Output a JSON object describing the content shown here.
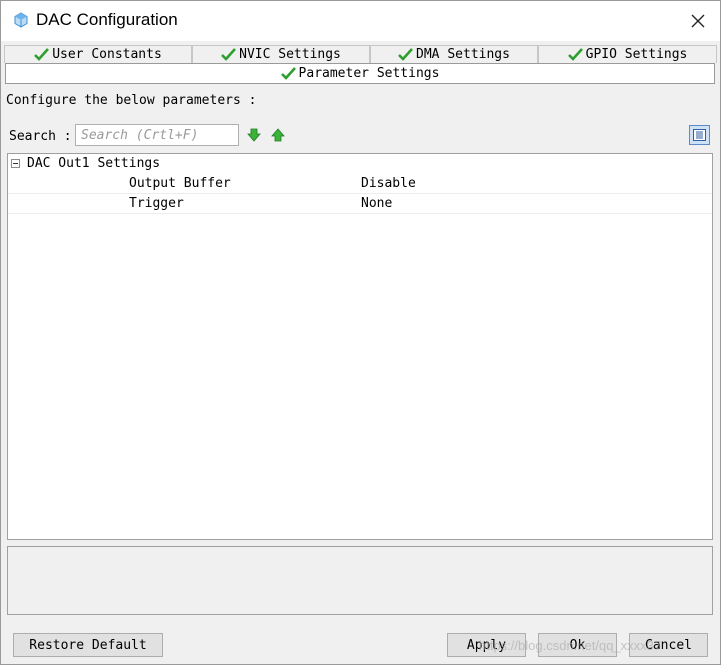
{
  "window": {
    "title": "DAC Configuration"
  },
  "tabs": [
    {
      "label": "User Constants",
      "checked": true
    },
    {
      "label": "NVIC Settings",
      "checked": true
    },
    {
      "label": "DMA Settings",
      "checked": true
    },
    {
      "label": "GPIO Settings",
      "checked": true
    }
  ],
  "active_tab": {
    "label": "Parameter Settings",
    "checked": true
  },
  "instructions": "Configure the below parameters :",
  "search": {
    "label": "Search :",
    "placeholder": "Search (Crtl+F)",
    "value": ""
  },
  "tree": {
    "group": {
      "label": "DAC Out1 Settings",
      "expanded": true,
      "rows": [
        {
          "name": "Output Buffer",
          "value": "Disable"
        },
        {
          "name": "Trigger",
          "value": "None"
        }
      ]
    }
  },
  "description": "",
  "buttons": {
    "restore": "Restore Default",
    "apply": "Apply",
    "ok": "Ok",
    "cancel": "Cancel"
  },
  "watermark": "https://blog.csdn.net/qq_xxxx37",
  "colors": {
    "check_green": "#2e9e2e",
    "arrow_green": "#3bb33b",
    "list_button_bg": "#cde2f7",
    "list_button_border": "#5e8ac7",
    "app_icon_blue": "#3b8fd6"
  },
  "icons": {
    "app": "cube-icon",
    "close": "close-icon",
    "tab_check": "checkmark-icon",
    "next": "arrow-down-icon",
    "prev": "arrow-up-icon",
    "list_view": "list-view-icon",
    "expander": "collapse-minus-icon"
  }
}
